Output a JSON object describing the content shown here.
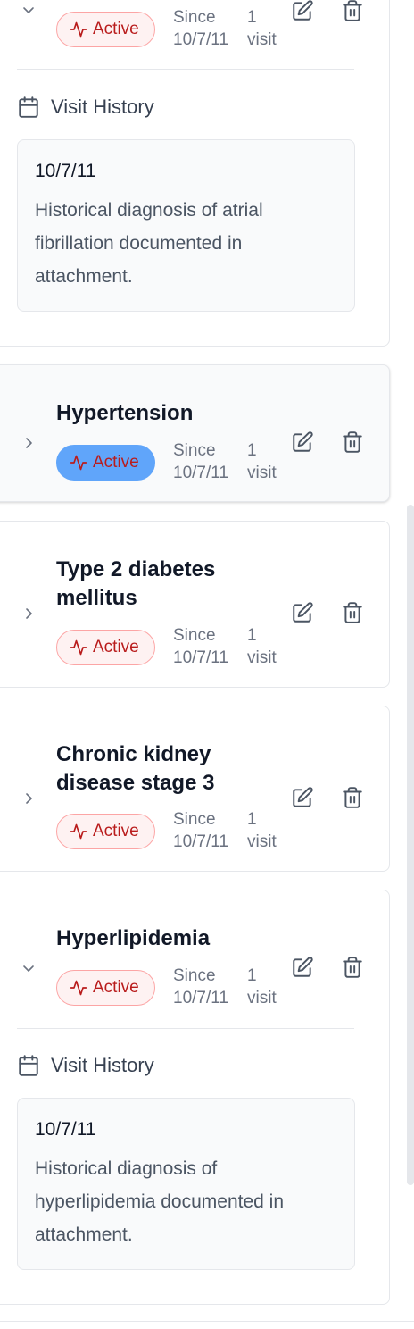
{
  "status_label": "Active",
  "conditions": [
    {
      "name": "",
      "status": "Active",
      "since_label": "Since",
      "since_date": "10/7/11",
      "visits_count": "1",
      "visits_word": "visit",
      "expanded": true,
      "visit_history_label": "Visit History",
      "visits": [
        {
          "date": "10/7/11",
          "note": "Historical diagnosis of atrial fibrillation documented in attachment."
        }
      ]
    },
    {
      "name": "Hypertension",
      "status": "Active",
      "since_label": "Since",
      "since_date": "10/7/11",
      "visits_count": "1",
      "visits_word": "visit",
      "expanded": false,
      "selected_badge": true
    },
    {
      "name": "Type 2 diabetes mellitus",
      "status": "Active",
      "since_label": "Since",
      "since_date": "10/7/11",
      "visits_count": "1",
      "visits_word": "visit",
      "expanded": false
    },
    {
      "name": "Chronic kidney disease stage 3",
      "status": "Active",
      "since_label": "Since",
      "since_date": "10/7/11",
      "visits_count": "1",
      "visits_word": "visit",
      "expanded": false
    },
    {
      "name": "Hyperlipidemia",
      "status": "Active",
      "since_label": "Since",
      "since_date": "10/7/11",
      "visits_count": "1",
      "visits_word": "visit",
      "expanded": true,
      "visit_history_label": "Visit History",
      "visits": [
        {
          "date": "10/7/11",
          "note": "Historical diagnosis of hyperlipidemia documented in attachment."
        }
      ]
    }
  ],
  "icons": {
    "expand": "chevron-right-icon",
    "collapse": "chevron-down-icon",
    "status": "activity-icon",
    "edit": "edit-icon",
    "delete": "trash-icon",
    "history": "calendar-icon"
  },
  "colors": {
    "active_badge_bg": "#fef2f2",
    "active_badge_border": "#fca5a5",
    "active_badge_text": "#b91c1c",
    "selected_badge_bg": "#60a5fa"
  }
}
